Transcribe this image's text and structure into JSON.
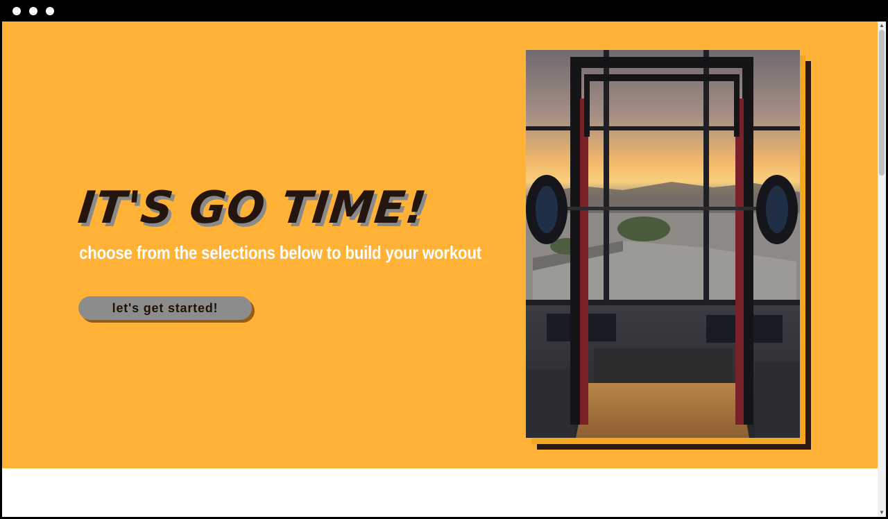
{
  "window": {
    "controls": [
      "close",
      "minimize",
      "maximize"
    ]
  },
  "hero": {
    "headline": "IT'S GO TIME!",
    "subheadline": "choose from the selections below to build your workout",
    "cta_label": "let's get started!",
    "background_color": "#ffb236",
    "headline_color": "#24150f",
    "cta_color": "#8c8c8c",
    "image": {
      "subject": "gym squat rack facing window at sunset",
      "icon": "gym-photo"
    }
  },
  "scrollbar": {
    "up_icon": "▲",
    "down_icon": "▼"
  }
}
